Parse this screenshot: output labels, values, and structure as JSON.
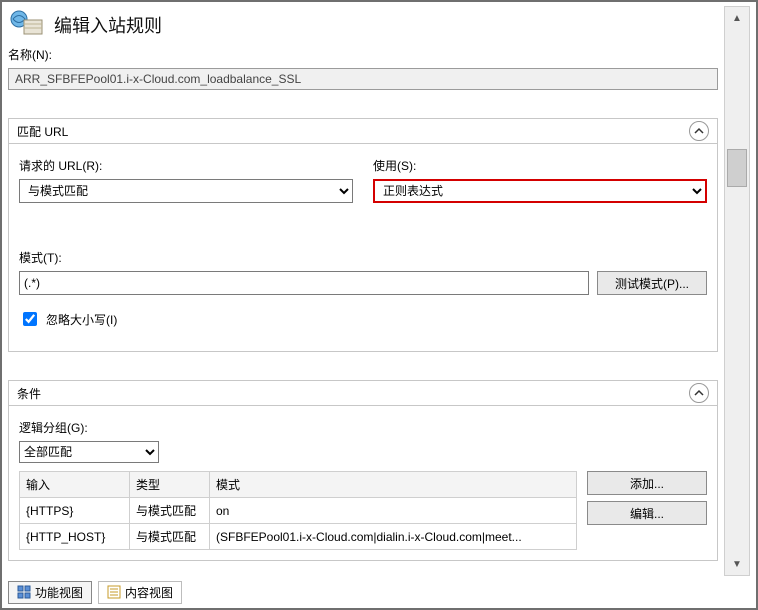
{
  "header": {
    "title": "编辑入站规则"
  },
  "nameField": {
    "label": "名称(N):",
    "value": "ARR_SFBFEPool01.i-x-Cloud.com_loadbalance_SSL"
  },
  "matchGroup": {
    "title": "匹配 URL",
    "requestedUrl": {
      "label": "请求的 URL(R):",
      "value": "与模式匹配"
    },
    "using": {
      "label": "使用(S):",
      "value": "正则表达式"
    },
    "pattern": {
      "label": "模式(T):",
      "value": "(.*)"
    },
    "testBtn": "测试模式(P)...",
    "ignoreCase": {
      "label": "忽略大小写(I)",
      "checked": true
    }
  },
  "conditionsGroup": {
    "title": "条件",
    "logic": {
      "label": "逻辑分组(G):",
      "value": "全部匹配"
    },
    "cols": {
      "input": "输入",
      "type": "类型",
      "pattern": "模式"
    },
    "rows": [
      {
        "input": "{HTTPS}",
        "type": "与模式匹配",
        "pattern": "on"
      },
      {
        "input": "{HTTP_HOST}",
        "type": "与模式匹配",
        "pattern": "(SFBFEPool01.i-x-Cloud.com|dialin.i-x-Cloud.com|meet..."
      }
    ],
    "addBtn": "添加...",
    "editBtn": "编辑..."
  },
  "footer": {
    "featuresView": "功能视图",
    "contentView": "内容视图"
  }
}
